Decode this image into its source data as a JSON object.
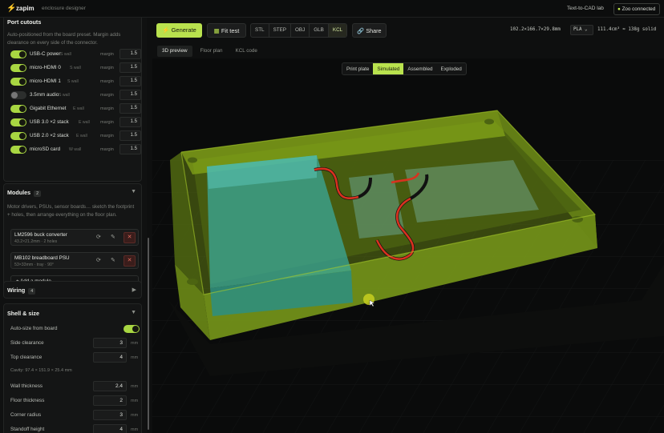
{
  "app": {
    "name": "zapim",
    "subtitle": "enclosure designer",
    "text_to_cad": "Text-to-CAD lab",
    "zoo_status": "Zoo connected"
  },
  "ports": {
    "title": "Port cutouts",
    "hint": "Auto-positioned from the board preset. Margin adds clearance on every side of the connector.",
    "items": [
      {
        "name": "USB-C power",
        "wall": "S wall",
        "margin_label": "margin",
        "margin": "1.5",
        "on": true
      },
      {
        "name": "micro-HDMI 0",
        "wall": "S wall",
        "margin_label": "margin",
        "margin": "1.5",
        "on": true
      },
      {
        "name": "micro-HDMI 1",
        "wall": "S wall",
        "margin_label": "margin",
        "margin": "1.5",
        "on": true
      },
      {
        "name": "3.5mm audio",
        "wall": "S wall",
        "margin_label": "margin",
        "margin": "1.5",
        "on": false
      },
      {
        "name": "Gigabit Ethernet",
        "wall": "E wall",
        "margin_label": "margin",
        "margin": "1.5",
        "on": true
      },
      {
        "name": "USB 3.0 ×2 stack",
        "wall": "E wall",
        "margin_label": "margin",
        "margin": "1.5",
        "on": true
      },
      {
        "name": "USB 2.0 ×2 stack",
        "wall": "E wall",
        "margin_label": "margin",
        "margin": "1.5",
        "on": true
      },
      {
        "name": "microSD card",
        "wall": "W wall",
        "margin_label": "margin",
        "margin": "1.5",
        "on": true
      }
    ]
  },
  "modules": {
    "title": "Modules",
    "count": "2",
    "hint": "Motor drivers, PSUs, sensor boards… sketch the footprint + holes, then arrange everything on the floor plan.",
    "items": [
      {
        "name": "LM2596 buck converter",
        "sub": "43.2×21.2mm · 2 holes"
      },
      {
        "name": "MB102 breadboard PSU",
        "sub": "53×33mm · tray · 90°"
      }
    ],
    "add_label": "+ Add a module…"
  },
  "wiring": {
    "title": "Wiring",
    "count": "4"
  },
  "shell": {
    "title": "Shell & size",
    "auto_size_label": "Auto-size from board",
    "cavity": "Cavity: 97.4 × 151.9 × 25.4 mm",
    "fields": [
      {
        "label": "Side clearance",
        "value": "3",
        "unit": "mm"
      },
      {
        "label": "Top clearance",
        "value": "4",
        "unit": "mm"
      },
      {
        "label": "Wall thickness",
        "value": "2.4",
        "unit": "mm"
      },
      {
        "label": "Floor thickness",
        "value": "2",
        "unit": "mm"
      },
      {
        "label": "Corner radius",
        "value": "3",
        "unit": "mm"
      },
      {
        "label": "Standoff height",
        "value": "4",
        "unit": "mm"
      }
    ]
  },
  "toolbar": {
    "generate": "Generate",
    "fit_test": "Fit test",
    "formats": [
      "STL",
      "STEP",
      "OBJ",
      "GLB",
      "KCL"
    ],
    "active_format": "KCL",
    "share": "Share",
    "dims": "102.2×166.7×29.8mm",
    "material": "PLA",
    "volume": "111.4cm³ ≈ 138g solid"
  },
  "view_tabs": [
    "3D preview",
    "Floor plan",
    "KCL code"
  ],
  "view_modes": [
    "Print plate",
    "Simulated",
    "Assembled",
    "Exploded"
  ],
  "colors": {
    "accent": "#b9e24e",
    "enclosure": "#8fb21a",
    "board": "#3aa89a",
    "wire_red": "#d8321f"
  }
}
